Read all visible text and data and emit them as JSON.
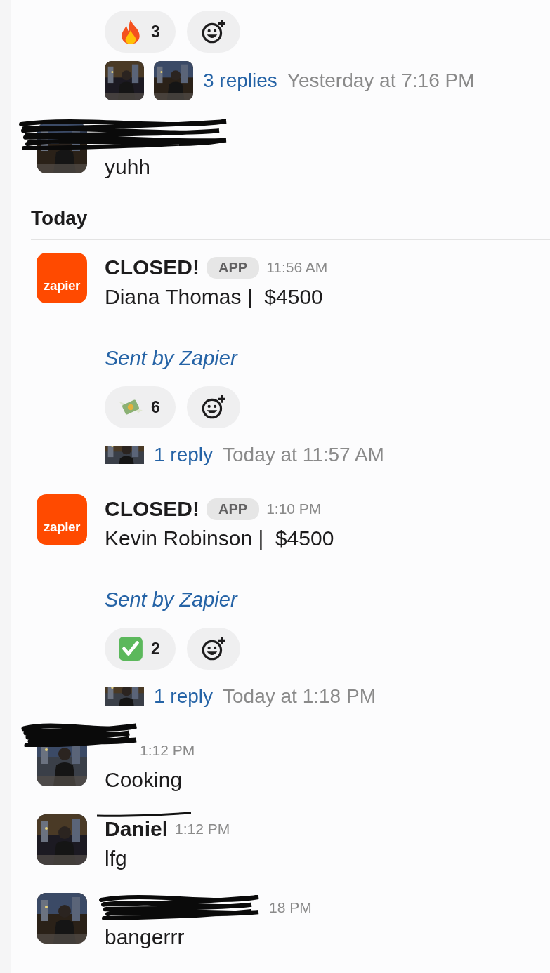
{
  "messages": [
    {
      "kind": "continuation",
      "reactions": [
        {
          "kind": "fire",
          "count": "3"
        }
      ],
      "thread": {
        "replies": "3 replies",
        "time": "Yesterday at 7:16 PM"
      }
    },
    {
      "kind": "user",
      "scribble": {
        "kind": "wide"
      },
      "body": "yuhh"
    },
    {
      "kind": "divider",
      "label": "Today"
    },
    {
      "kind": "user",
      "avatar": {
        "kind": "logo",
        "text": "zapier"
      },
      "name": "CLOSED!",
      "badge": "APP",
      "time": "11:56 AM",
      "body": "Diana Thomas |  $4500",
      "footer": "Sent by Zapier",
      "reactions": [
        {
          "kind": "money",
          "count": "6"
        }
      ],
      "thread": {
        "replies": "1 reply",
        "time": "Today at 11:57 AM"
      }
    },
    {
      "kind": "user",
      "avatar": {
        "kind": "logo",
        "text": "zapier"
      },
      "name": "CLOSED!",
      "badge": "APP",
      "time": "1:10 PM",
      "body": "Kevin Robinson |  $4500",
      "footer": "Sent by Zapier",
      "reactions": [
        {
          "kind": "check",
          "count": "2"
        }
      ],
      "thread": {
        "replies": "1 reply",
        "time": "Today at 1:18 PM"
      }
    },
    {
      "kind": "user",
      "scribble": {
        "kind": "short"
      },
      "time": "1:12 PM",
      "body": "Cooking"
    },
    {
      "kind": "user",
      "scribble": {
        "kind": "strike"
      },
      "name": "Daniel",
      "time": "1:12 PM",
      "body": "lfg"
    },
    {
      "kind": "user",
      "scribble": {
        "kind": "long"
      },
      "time": "18 PM",
      "body": "bangerrr"
    }
  ]
}
